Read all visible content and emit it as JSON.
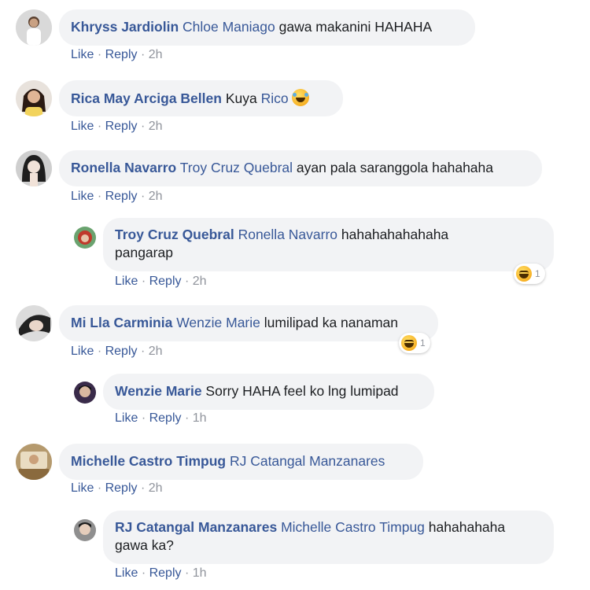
{
  "actions": {
    "like": "Like",
    "reply": "Reply",
    "dot": "·"
  },
  "comments": [
    {
      "author": "Khryss Jardiolin",
      "mention": "Chloe Maniago",
      "text": "gawa makanini HAHAHA",
      "time": "2h"
    },
    {
      "author": "Rica May Arciga Bellen",
      "text_before": "Kuya",
      "mention": "Rico",
      "emoji": "face-with-tears-of-joy-icon",
      "time": "2h"
    },
    {
      "author": "Ronella Navarro",
      "mention": "Troy Cruz Quebral",
      "text": "ayan pala saranggola hahahaha",
      "time": "2h"
    },
    {
      "author": "Troy Cruz Quebral",
      "mention": "Ronella Navarro",
      "text": "hahahahahahaha",
      "text_line2": "pangarap",
      "time": "2h",
      "reaction_count": "1",
      "reaction": "haha-reaction-icon"
    },
    {
      "author": "Mi Lla Carminia",
      "mention": "Wenzie Marie",
      "text": "lumilipad ka nanaman",
      "time": "2h",
      "reaction_count": "1",
      "reaction": "haha-reaction-icon"
    },
    {
      "author": "Wenzie Marie",
      "text": "Sorry HAHA feel ko lng lumipad",
      "time": "1h"
    },
    {
      "author": "Michelle Castro Timpug",
      "mention": "RJ Catangal Manzanares",
      "time": "2h"
    },
    {
      "author": "RJ Catangal Manzanares",
      "mention": "Michelle Castro Timpug",
      "text": "hahahahaha",
      "text_line2": "gawa ka?",
      "time": "1h"
    }
  ],
  "colors": {
    "link": "#385898",
    "meta": "#90949c",
    "bubble": "#f2f3f5",
    "text": "#1c1e21"
  }
}
